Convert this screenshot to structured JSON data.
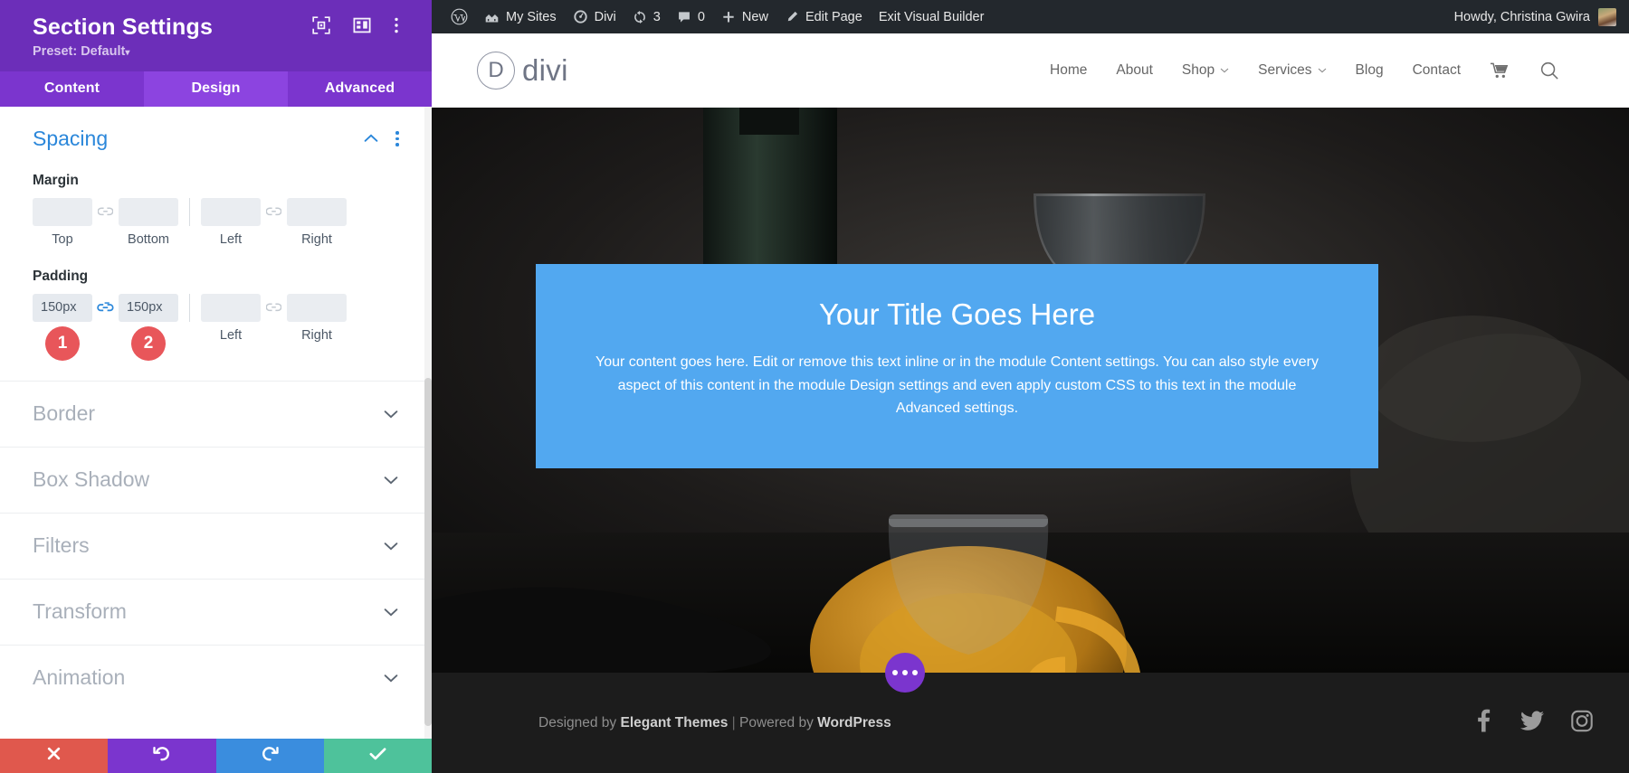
{
  "settings_panel": {
    "title": "Section Settings",
    "preset_label": "Preset: Default",
    "preset_caret": "▾",
    "header_icons": [
      {
        "name": "focus-target-icon"
      },
      {
        "name": "layout-columns-icon"
      },
      {
        "name": "more-vertical-icon"
      }
    ],
    "tabs": [
      {
        "label": "Content",
        "active": false
      },
      {
        "label": "Design",
        "active": true
      },
      {
        "label": "Advanced",
        "active": false
      }
    ],
    "spacing": {
      "title": "Spacing",
      "collapse_icon": "chevron-up-icon",
      "options_icon": "more-vertical-icon",
      "margin": {
        "label": "Margin",
        "fields": [
          {
            "sub": "Top",
            "value": "",
            "linked": false
          },
          {
            "sub": "Bottom",
            "value": "",
            "linked": false
          },
          {
            "sub": "Left",
            "value": "",
            "linked": false
          },
          {
            "sub": "Right",
            "value": "",
            "linked": false
          }
        ],
        "link_left_state": "unlinked",
        "link_right_state": "unlinked"
      },
      "padding": {
        "label": "Padding",
        "fields": [
          {
            "sub": "Top",
            "value": "150px",
            "linked": true
          },
          {
            "sub": "Bottom",
            "value": "150px",
            "linked": true
          },
          {
            "sub": "Left",
            "value": "",
            "linked": false
          },
          {
            "sub": "Right",
            "value": "",
            "linked": false
          }
        ],
        "link_left_state": "linked",
        "link_right_state": "unlinked",
        "badges": [
          "1",
          "2"
        ],
        "badge_color": "#e8565a"
      }
    },
    "accordions": [
      {
        "label": "Border",
        "icon": "chevron-down-icon"
      },
      {
        "label": "Box Shadow",
        "icon": "chevron-down-icon"
      },
      {
        "label": "Filters",
        "icon": "chevron-down-icon"
      },
      {
        "label": "Transform",
        "icon": "chevron-down-icon"
      },
      {
        "label": "Animation",
        "icon": "chevron-down-icon"
      }
    ],
    "footer_buttons": [
      {
        "name": "cancel-button",
        "icon": "close-x-icon",
        "color": "#e0584d"
      },
      {
        "name": "undo-button",
        "icon": "undo-arrow-icon",
        "color": "#7b35ce"
      },
      {
        "name": "redo-button",
        "icon": "redo-arrow-icon",
        "color": "#3a8dde"
      },
      {
        "name": "save-button",
        "icon": "check-icon",
        "color": "#4ec29b"
      }
    ],
    "colors": {
      "header_bg": "#6c2eb9",
      "tab_bg": "#7b35ce",
      "tab_active_bg": "#8c44e0",
      "section_title": "#2b87da"
    }
  },
  "adminbar": {
    "items": [
      {
        "label": "",
        "icon": "wordpress-logo-icon"
      },
      {
        "label": "My Sites",
        "icon": "sites-house-icon"
      },
      {
        "label": "Divi",
        "icon": "dashboard-gauge-icon"
      },
      {
        "label": "3",
        "icon": "updates-refresh-icon"
      },
      {
        "label": "0",
        "icon": "comment-bubble-icon"
      },
      {
        "label": "New",
        "icon": "plus-icon"
      },
      {
        "label": "Edit Page",
        "icon": "pencil-icon"
      },
      {
        "label": "Exit Visual Builder",
        "icon": ""
      }
    ],
    "howdy": "Howdy, Christina Gwira",
    "avatar_name": "user-avatar"
  },
  "site_header": {
    "logo_mark": "D",
    "logo_text": "divi",
    "nav": [
      {
        "label": "Home",
        "has_dropdown": false
      },
      {
        "label": "About",
        "has_dropdown": false
      },
      {
        "label": "Shop",
        "has_dropdown": true
      },
      {
        "label": "Services",
        "has_dropdown": true
      },
      {
        "label": "Blog",
        "has_dropdown": false
      },
      {
        "label": "Contact",
        "has_dropdown": false
      }
    ],
    "cart_icon": "shopping-cart-icon",
    "search_icon": "search-icon",
    "caret": "⌄"
  },
  "hero": {
    "cta_title": "Your Title Goes Here",
    "cta_body": "Your content goes here. Edit or remove this text inline or in the module Content settings. You can also style every aspect of this content in the module Design settings and even apply custom CSS to this text in the module Advanced settings.",
    "cta_bg": "#52a8f0"
  },
  "site_footer": {
    "credit_prefix": "Designed by ",
    "credit_brand1": "Elegant Themes",
    "credit_sep": " | ",
    "credit_mid": "Powered by ",
    "credit_brand2": "WordPress",
    "social": [
      {
        "name": "facebook-icon"
      },
      {
        "name": "twitter-icon"
      },
      {
        "name": "instagram-icon"
      }
    ],
    "fab_name": "page-settings-fab",
    "fab_color": "#7b35ce"
  }
}
